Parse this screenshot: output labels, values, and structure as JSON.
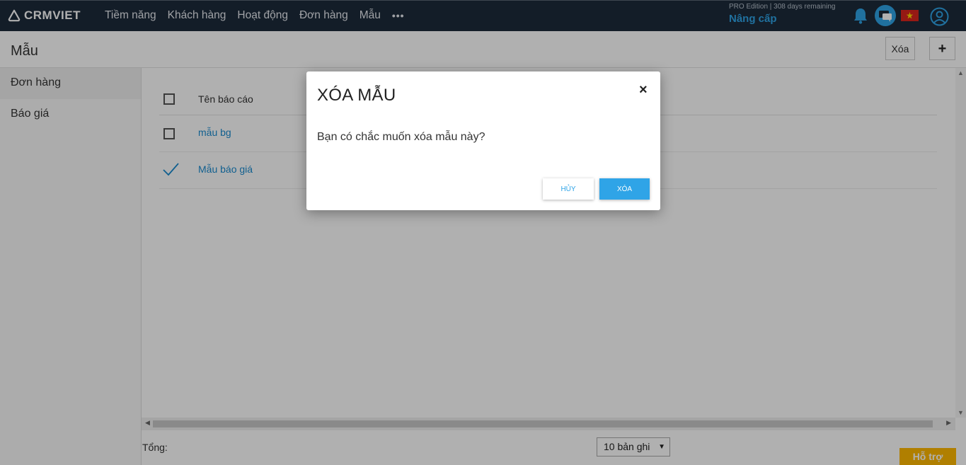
{
  "app": {
    "brand": "CRMVIET",
    "nav": [
      "Tiềm năng",
      "Khách hàng",
      "Hoạt động",
      "Đơn hàng",
      "Mẫu"
    ],
    "more": "•••",
    "edition": "PRO Edition | 308 days remaining",
    "upgrade": "Nâng cấp",
    "icons": [
      "bell-icon",
      "chat-icon",
      "vietnam-flag-icon",
      "user-avatar-icon"
    ],
    "colors": {
      "topbar": "#1c2a3b",
      "accent": "#2fa4e7",
      "support": "#ffb800"
    }
  },
  "page": {
    "title": "Mẫu",
    "delete_label": "Xóa",
    "add_label": "+"
  },
  "sidebar": {
    "items": [
      {
        "label": "Đơn hàng"
      },
      {
        "label": "Báo giá"
      }
    ]
  },
  "table": {
    "header": "Tên báo cáo",
    "rows": [
      {
        "label": "mẫu bg",
        "checked": false
      },
      {
        "label": "Mẫu báo giá",
        "checked": true
      }
    ]
  },
  "footer": {
    "total_label": "Tổng:",
    "page_size": "10 bản ghi",
    "support": "Hỗ trợ"
  },
  "modal": {
    "title": "XÓA MẪU",
    "close": "×",
    "message": "Bạn có chắc muốn xóa mẫu này?",
    "cancel": "HỦY",
    "confirm": "XÓA"
  }
}
